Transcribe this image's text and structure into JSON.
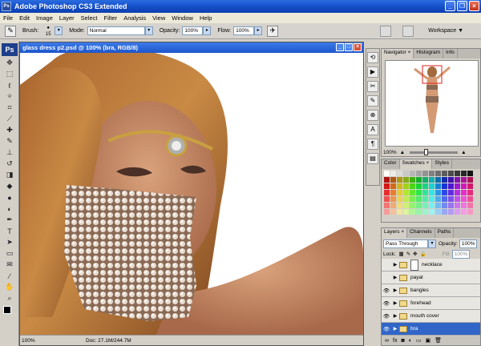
{
  "app": {
    "title": "Adobe Photoshop CS3 Extended",
    "logo": "Ps"
  },
  "menu": [
    "File",
    "Edit",
    "Image",
    "Layer",
    "Select",
    "Filter",
    "Analysis",
    "View",
    "Window",
    "Help"
  ],
  "options": {
    "brush_label": "Brush:",
    "brush_size": "15",
    "mode_label": "Mode:",
    "mode_value": "Normal",
    "opacity_label": "Opacity:",
    "opacity_value": "100%",
    "flow_label": "Flow:",
    "flow_value": "100%",
    "workspace": "Workspace ▼"
  },
  "document": {
    "title": "glass dress p2.psd @ 100% (bra, RGB/8)",
    "zoom": "100%",
    "status_zoom": "100%",
    "doc_info": "Doc: 27.1M/244.7M"
  },
  "navigator": {
    "tabs": [
      "Navigator ×",
      "Histogram",
      "Info"
    ],
    "zoom": "100%"
  },
  "swatches": {
    "tabs": [
      "Color",
      "Swatches ×",
      "Styles"
    ]
  },
  "layers": {
    "tabs": [
      "Layers ×",
      "Channels",
      "Paths"
    ],
    "blend_mode": "Pass Through",
    "opacity_label": "Opacity:",
    "opacity_value": "100%",
    "lock_label": "Lock:",
    "fill_label": "Fill:",
    "fill_value": "100%",
    "items": [
      {
        "name": "necklace",
        "visible": false,
        "selected": false
      },
      {
        "name": "payal",
        "visible": false,
        "selected": false
      },
      {
        "name": "bangles",
        "visible": true,
        "selected": false
      },
      {
        "name": "forehead",
        "visible": true,
        "selected": false
      },
      {
        "name": "mouth cover",
        "visible": true,
        "selected": false
      },
      {
        "name": "bra",
        "visible": true,
        "selected": true
      }
    ]
  },
  "colors": {
    "title_bar": "#1550c8",
    "selected_layer": "#3166c8"
  }
}
